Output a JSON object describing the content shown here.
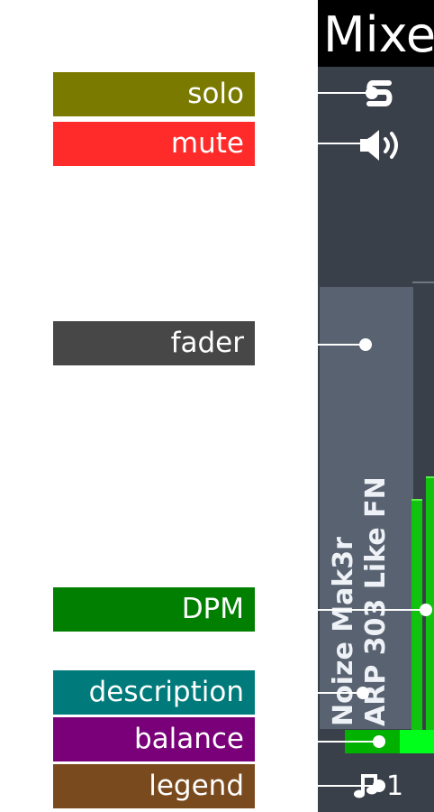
{
  "callouts": {
    "solo": "solo",
    "mute": "mute",
    "fader": "fader",
    "dpm": "DPM",
    "description": "description",
    "balance": "balance",
    "legend": "legend"
  },
  "mixer": {
    "title": "Mixer",
    "description_lines": [
      "Noize Mak3r",
      "ARP 303 Like FN"
    ],
    "legend_icon": "music-note-icon",
    "legend_text": "1",
    "dpm": {
      "left_level": 0.55,
      "right_level": 0.6
    },
    "balance": 0.62
  },
  "colors": {
    "solo_label": "#7a7a00",
    "mute_label": "#ff2a2a",
    "fader_label": "#474747",
    "dpm_label": "#007f00",
    "description_label": "#007a7a",
    "balance_label": "#7a007a",
    "legend_label": "#7a4a1f",
    "mixer_bg": "#3a404a",
    "dpm_bar": "#11c20f",
    "balance_track": "#00b100",
    "balance_fill": "#00ff1b"
  }
}
